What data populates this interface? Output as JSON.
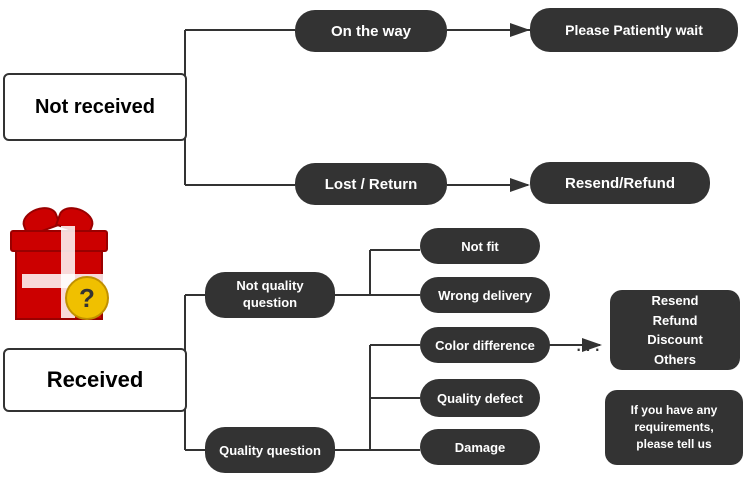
{
  "boxes": {
    "not_received": "Not received",
    "on_the_way": "On the way",
    "please_wait": "Please Patiently wait",
    "lost_return": "Lost / Return",
    "resend_refund": "Resend/Refund",
    "received": "Received",
    "not_quality_question": "Not quality\nquestion",
    "quality_question": "Quality question",
    "not_fit": "Not fit",
    "wrong_delivery": "Wrong delivery",
    "color_difference": "Color difference",
    "quality_defect": "Quality defect",
    "damage": "Damage",
    "resolutions": "Resend\nRefund\nDiscount\nOthers",
    "requirements": "If you have any\nrequirements,\nplease tell us"
  }
}
